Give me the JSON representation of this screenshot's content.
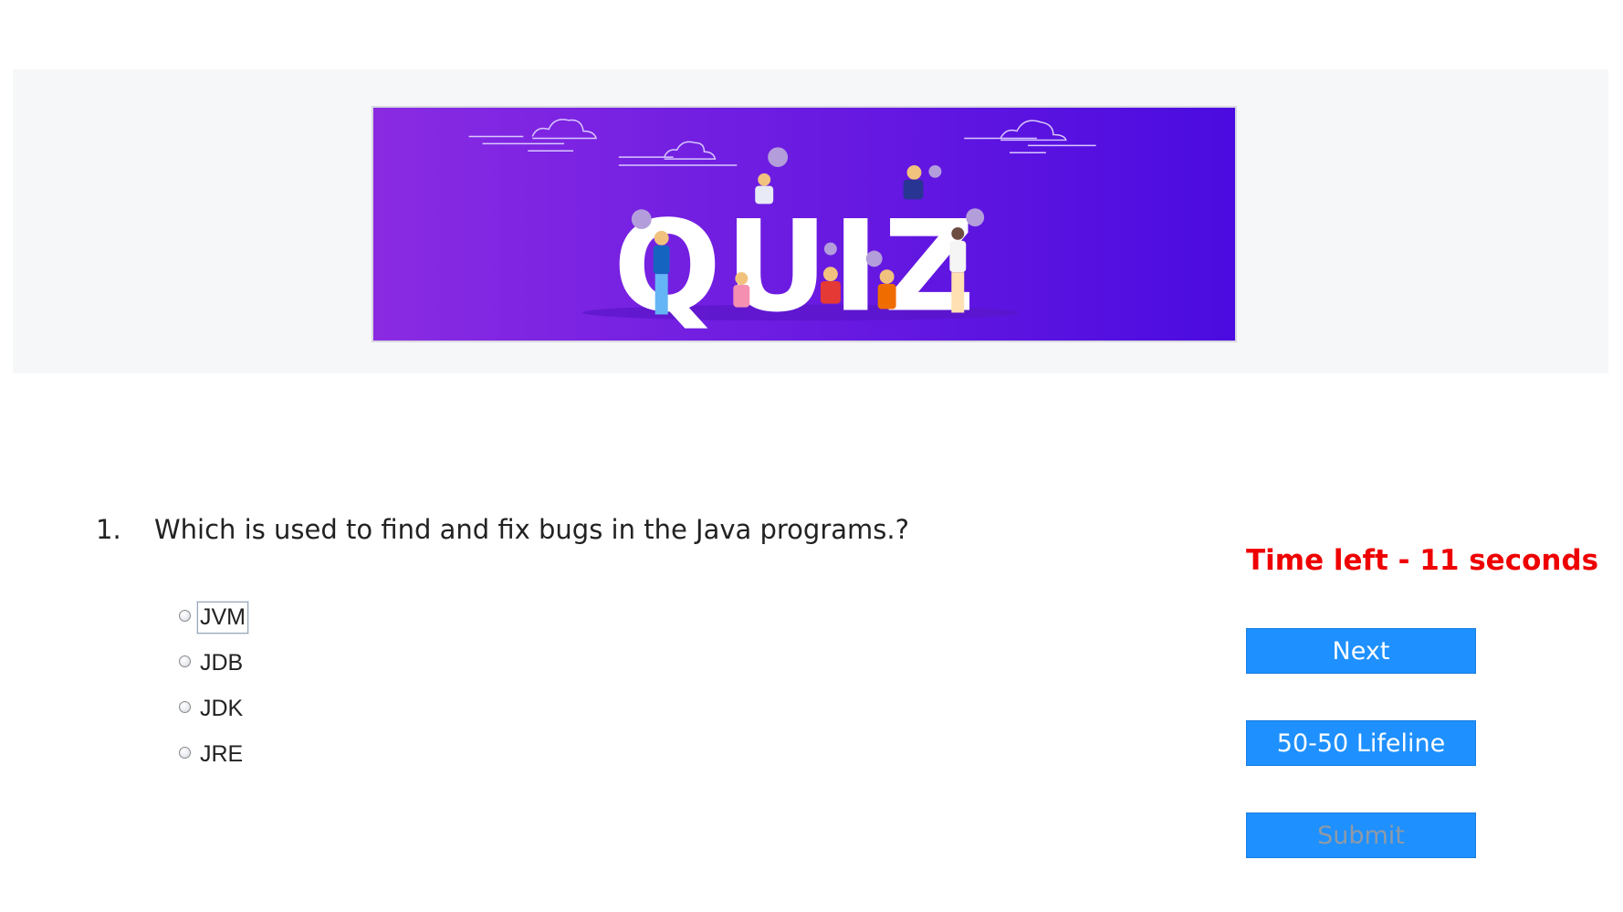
{
  "banner": {
    "title_text": "QUIZ",
    "colors": {
      "gradient_start": "#8a2be2",
      "gradient_end": "#4b0be0",
      "letters": "#ffffff"
    }
  },
  "question": {
    "number": "1.",
    "text": "Which is used to find and fix bugs in the Java programs.?"
  },
  "options": [
    {
      "label": "JVM",
      "selected": false
    },
    {
      "label": "JDB",
      "selected": false
    },
    {
      "label": "JDK",
      "selected": false
    },
    {
      "label": "JRE",
      "selected": false
    }
  ],
  "timer": {
    "text": "Time left - 11 seconds",
    "color": "#ee0000"
  },
  "buttons": {
    "next_label": "Next",
    "lifeline_label": "50-50 Lifeline",
    "submit_label": "Submit",
    "color": "#1e90ff"
  }
}
